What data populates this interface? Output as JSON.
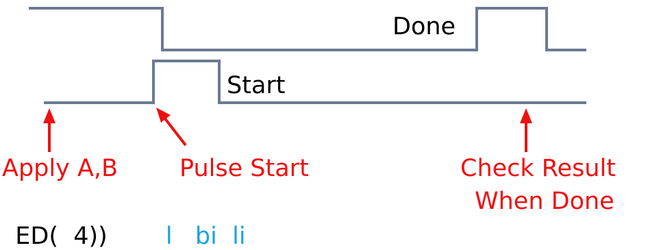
{
  "colors": {
    "signal": "#6b7a93",
    "label": "#000000",
    "annotation": "#ee1111",
    "link": "#1aa3e0"
  },
  "signals": {
    "done_label": "Done",
    "start_label": "Start"
  },
  "annotations": {
    "apply_ab": "Apply A,B",
    "pulse_start": "Pulse Start",
    "check_result_line1": "Check Result",
    "check_result_line2": "When Done"
  },
  "bottom_cut": {
    "left_text": "ED(  4))",
    "link_text": "l   bi  li"
  }
}
